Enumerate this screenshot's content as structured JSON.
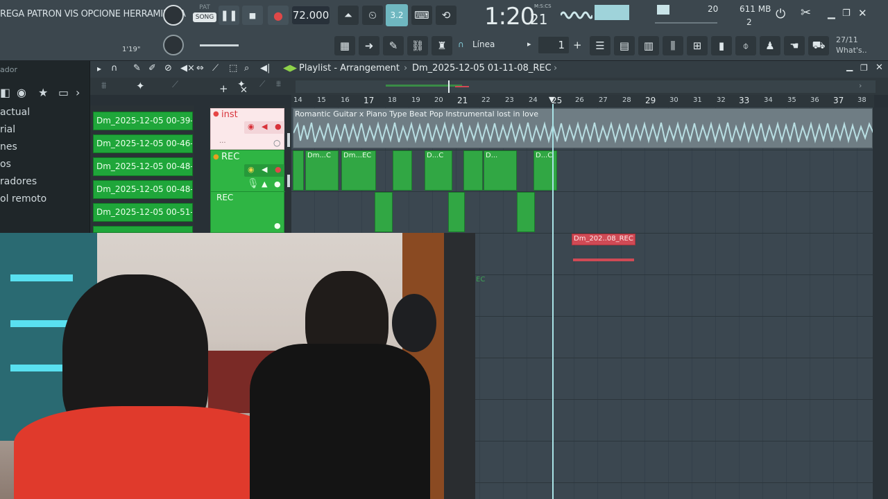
{
  "menu": {
    "left_text": "REGA PATRON VIS OPCIONE HERRAMIENTA"
  },
  "transport": {
    "pat_label": "PAT",
    "song_label": "SONG",
    "tempo": "72.000",
    "time_main": "1:20",
    "time_sub": "21",
    "time_format": "M:S:CS",
    "pattern_number": "1",
    "snap_label": "Línea",
    "step_label": "3.2",
    "time_elapsed": "1'19\""
  },
  "stats": {
    "cpu_value": "20",
    "memory": "611 MB",
    "polyphony": "2"
  },
  "news": {
    "date": "27/11",
    "text": "What's.."
  },
  "browser": {
    "title": "ador",
    "items": [
      "actual",
      "rial",
      "nes",
      "os",
      "radores",
      "ol remoto"
    ]
  },
  "playlist": {
    "title": "Playlist - Arrangement",
    "arrangement_name": "Dm_2025-12-05 01-11-08_REC",
    "ruler_ticks": [
      "14",
      "15",
      "16",
      "17",
      "18",
      "19",
      "20",
      "21",
      "22",
      "23",
      "24",
      "25",
      "26",
      "27",
      "28",
      "29",
      "30",
      "31",
      "32",
      "33",
      "34",
      "35",
      "36",
      "37",
      "38"
    ],
    "patterns": [
      "Dm_2025-12-05 00-39-...",
      "Dm_2025-12-05 00-46-...",
      "Dm_2025-12-05 00-48-...",
      "Dm_2025-12-05 00-48-...",
      "Dm_2025-12-05 00-51-..."
    ],
    "tracks": [
      {
        "name": "inst",
        "color": "#e64545"
      },
      {
        "name": "REC",
        "color": "#e6a020"
      },
      {
        "name": "REC",
        "color": "#e6a020"
      }
    ],
    "audio_clip_label": "Romantic Guitar x Piano Type Beat  Pop Instrumental  lost in love",
    "rec_clips": [
      {
        "label": ""
      },
      {
        "label": "Dm...C"
      },
      {
        "label": "Dm...EC"
      },
      {
        "label": ""
      },
      {
        "label": "D...C"
      },
      {
        "label": ""
      },
      {
        "label": "D..."
      },
      {
        "label": "D...C"
      }
    ],
    "muted_clip_label": "Dm_202..08_REC",
    "edge_label": "EC"
  },
  "colors": {
    "accent_green": "#1fa63a",
    "playhead": "#a9e3e6",
    "audio_wave": "#b9dfe3",
    "muted_clip": "#d04a55"
  }
}
